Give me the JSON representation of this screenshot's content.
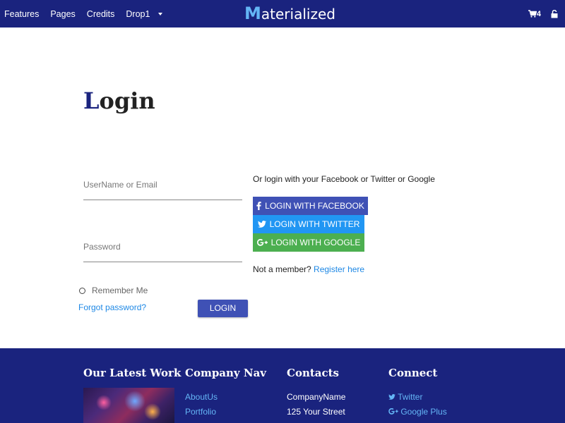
{
  "navbar": {
    "links": [
      "Features",
      "Pages",
      "Credits"
    ],
    "dropdown_label": "Drop1",
    "brand_initial": "M",
    "brand_rest": "aterialized",
    "cart_count": "4",
    "cart_icon": "cart-icon",
    "lock_icon": "lock-icon"
  },
  "login": {
    "title_first": "L",
    "title_rest": "ogin",
    "username_placeholder": "UserName or Email",
    "password_placeholder": "Password",
    "remember_label": "Remember Me",
    "forgot_label": "Forgot password?",
    "login_button": "LOGIN"
  },
  "social": {
    "intro": "Or login with your Facebook or Twitter or Google",
    "facebook_label": "LOGIN WITH FACEBOOK",
    "twitter_label": "LOGIN WITH TWITTER",
    "google_label": "LOGIN WITH GOOGLE",
    "member_text": "Not a member?",
    "register_label": "Register here"
  },
  "footer": {
    "latest_work": {
      "heading": "Our Latest Work"
    },
    "company_nav": {
      "heading": "Company Nav",
      "links": [
        "AboutUs",
        "Portfolio"
      ]
    },
    "contacts": {
      "heading": "Contacts",
      "lines": [
        "CompanyName",
        "125 Your Street"
      ]
    },
    "connect": {
      "heading": "Connect",
      "twitter": "Twitter",
      "google_plus": "Google Plus"
    }
  },
  "colors": {
    "navbar_bg": "#1a237e",
    "brand_accent": "#64b5f6",
    "primary_button": "#3f51b5",
    "twitter": "#2196f3",
    "google": "#4caf50",
    "link": "#1e88e5"
  }
}
